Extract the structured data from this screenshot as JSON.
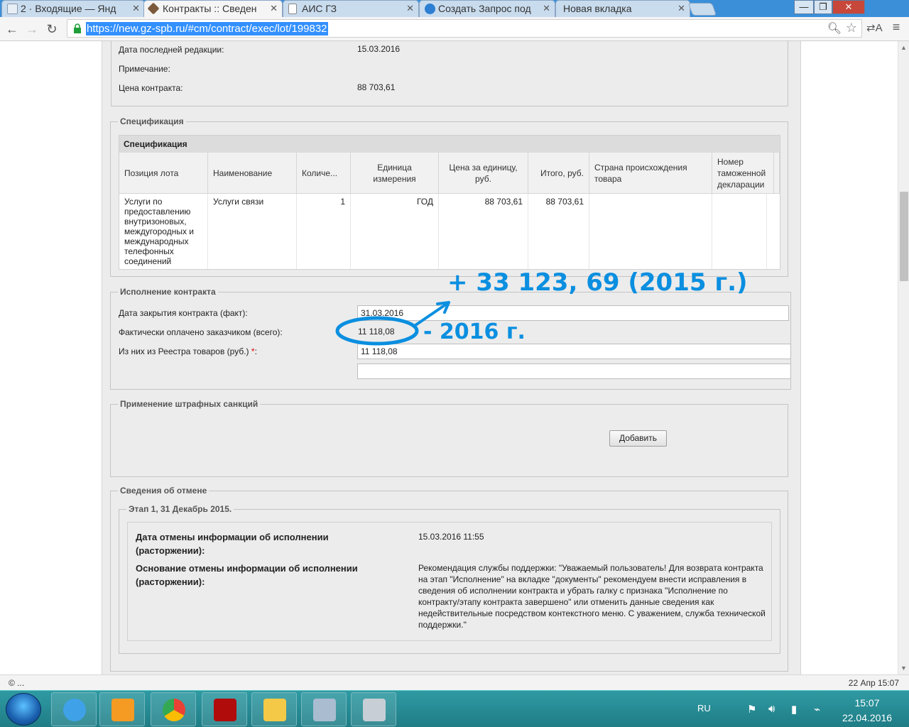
{
  "browser": {
    "tabs": [
      {
        "label": "2 · Входящие — Янд",
        "icon": "mail-icon"
      },
      {
        "label": "Контракты :: Сведен",
        "icon": "hammer-icon",
        "active": true
      },
      {
        "label": "АИС ГЗ",
        "icon": "page-icon"
      },
      {
        "label": "Создать Запрос под",
        "icon": "help-icon"
      },
      {
        "label": "Новая вкладка",
        "icon": ""
      }
    ],
    "url": "https://new.gz-spb.ru/#cm/contract/exec/lot/199832",
    "window_buttons": {
      "minimize": "—",
      "maximize": "❐",
      "close": "✕"
    }
  },
  "contract": {
    "last_edit_label": "Дата последней редакции:",
    "last_edit_value": "15.03.2016",
    "note_label": "Примечание:",
    "price_label": "Цена контракта:",
    "price_value": "88 703,61"
  },
  "spec": {
    "legend": "Спецификация",
    "grid_title": "Спецификация",
    "columns": [
      "Позиция лота",
      "Наименование",
      "Количе...",
      "Единица измерения",
      "Цена за единицу, руб.",
      "Итого, руб.",
      "Страна происхождения товара",
      "Номер таможенной декларации"
    ],
    "rows": [
      {
        "position": "Услуги по предоставлению внутризоновых, междугородных и международных телефонных соединений",
        "name": "Услуги связи",
        "qty": "1",
        "unit": "ГОД",
        "unit_price": "88 703,61",
        "total": "88 703,61",
        "country": "",
        "customs": ""
      }
    ]
  },
  "execution": {
    "legend": "Исполнение контракта",
    "close_date_label": "Дата закрытия контракта (факт):",
    "close_date_value": "31.03.2016",
    "paid_label": "Фактически оплачено заказчиком (всего):",
    "paid_value": "11 118,08",
    "registry_label": "Из них из Реестра товаров (руб.)",
    "required_mark": "*",
    "registry_colon": ":",
    "registry_value": "11 118,08"
  },
  "penalties": {
    "legend": "Применение штрафных санкций",
    "add_button": "Добавить"
  },
  "cancellation": {
    "legend": "Сведения об отмене",
    "stage_legend": "Этап 1, 31 Декабрь 2015.",
    "date_label": "Дата отмены информации об исполнении (расторжении):",
    "date_value": "15.03.2016 11:55",
    "reason_label": "Основание отмены информации об исполнении (расторжении):",
    "reason_value": "Рекомендация службы поддержки: \"Уважаемый пользователь! Для возврата контракта на этап \"Исполнение\" на вкладке \"документы\" рекомендуем внести исправления в сведения об исполнении контракта и убрать галку с признака \"Исполнение по контракту/этапу контракта завершено\" или отменить данные сведения как недействительные посредством контекстного меню. С уважением, служба технической поддержки.\""
  },
  "annotations": {
    "top_note": "+ 33 123, 69 (2015 г.)",
    "side_note": "- 2016 г.",
    "color": "#0b8fe0"
  },
  "status": {
    "left": "© ...",
    "right": "22 Апр 15:07"
  },
  "taskbar": {
    "apps": [
      "ie-icon",
      "media-player-icon",
      "chrome-icon",
      "acrobat-icon",
      "folder-icon",
      "calculator-icon",
      "fax-icon"
    ],
    "lang": "RU",
    "time": "15:07",
    "date": "22.04.2016"
  }
}
